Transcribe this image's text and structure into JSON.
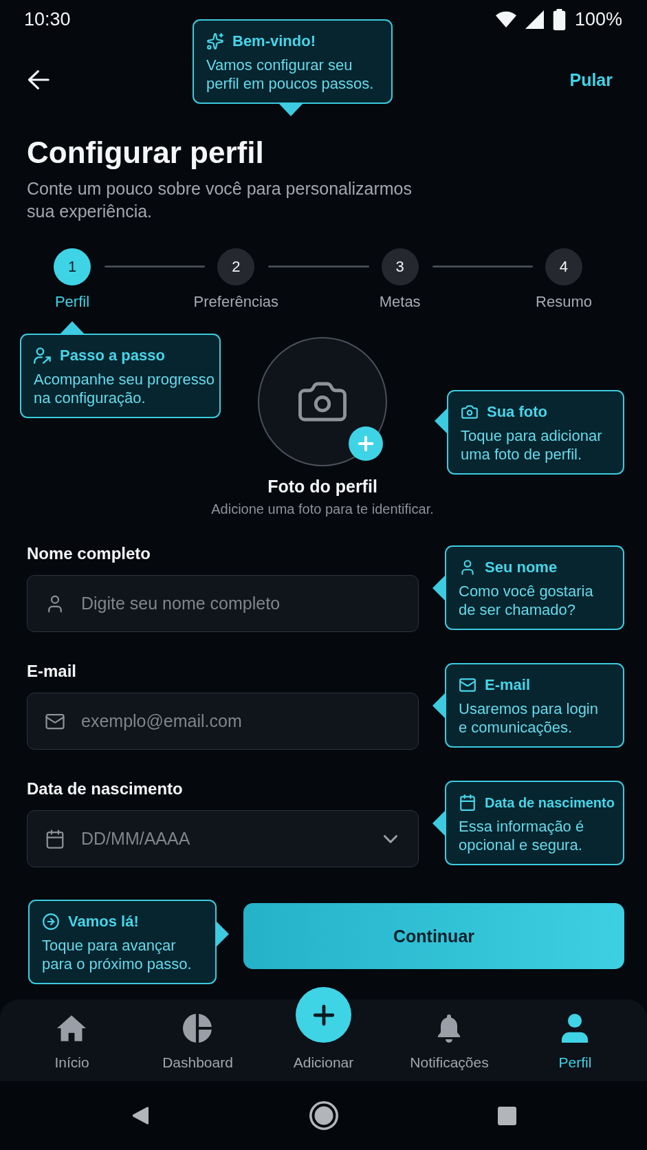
{
  "status_bar": {
    "time": "10:30",
    "battery": "100%"
  },
  "welcome_tip": {
    "title": "Bem-vindo!",
    "text": "Vamos configurar seu perfil em poucos passos."
  },
  "header": {
    "skip": "Pular"
  },
  "title": "Configurar perfil",
  "subtitle": "Conte um pouco sobre você para personalizarmos sua experiência.",
  "steps": [
    {
      "number": "1",
      "label": "Perfil",
      "current": true
    },
    {
      "number": "2",
      "label": "Preferências",
      "current": false
    },
    {
      "number": "3",
      "label": "Metas",
      "current": false
    },
    {
      "number": "4",
      "label": "Resumo",
      "current": false
    }
  ],
  "steps_tip": {
    "title": "Passo a passo",
    "text": "Acompanhe seu progresso na configuração."
  },
  "photo": {
    "title": "Foto do perfil",
    "hint": "Adicione uma foto para te identificar.",
    "tip": {
      "title": "Sua foto",
      "text": "Toque para adicionar uma foto de perfil."
    }
  },
  "fields": [
    {
      "kind": "name",
      "label": "Nome completo",
      "placeholder": "Digite seu nome completo",
      "tip": {
        "title": "Seu nome",
        "text": "Como você gostaria de ser chamado?"
      }
    },
    {
      "kind": "email",
      "label": "E-mail",
      "placeholder": "exemplo@email.com",
      "tip": {
        "title": "E-mail",
        "text": "Usaremos para login e comunicações."
      }
    },
    {
      "kind": "date",
      "label": "Data de nascimento",
      "placeholder": "DD/MM/AAAA",
      "tip": {
        "title": "Data de nascimento",
        "text": "Essa informação é opcional e segura."
      }
    }
  ],
  "continue": {
    "label": "Continuar",
    "tip": {
      "title": "Vamos lá!",
      "text": "Toque para avançar para o próximo passo."
    }
  },
  "bottom_nav": [
    {
      "kind": "home",
      "label": "Início",
      "selected": false
    },
    {
      "kind": "dashboard",
      "label": "Dashboard",
      "selected": false
    },
    {
      "kind": "add",
      "label": "Adicionar",
      "selected": false
    },
    {
      "kind": "notifications",
      "label": "Notificações",
      "selected": false
    },
    {
      "kind": "profile",
      "label": "Perfil",
      "selected": true
    }
  ]
}
